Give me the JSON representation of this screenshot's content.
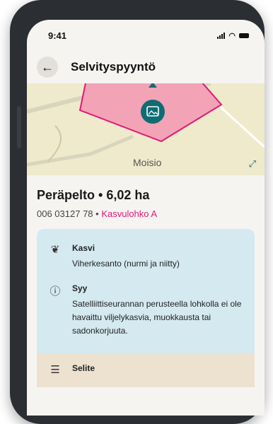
{
  "status": {
    "time": "9:41"
  },
  "appbar": {
    "title": "Selvityspyyntö",
    "back_icon": "arrow-left-icon"
  },
  "map": {
    "place_label": "Moisio",
    "parcel_color": "#f2a3b6",
    "border_color": "#e0197a",
    "marker_color": "#0f6c73"
  },
  "field": {
    "name": "Peräpelto • 6,02 ha",
    "id": "006 03127 78",
    "separator": " • ",
    "block": "Kasvulohko A"
  },
  "details": [
    {
      "icon": "leaf-icon",
      "label": "Kasvi",
      "value": "Viherkesanto (nurmi ja niitty)"
    },
    {
      "icon": "info-icon",
      "label": "Syy",
      "value": "Satelliittiseurannan perusteella lohkolla ei ole havaittu viljelykasvia, muokkausta tai sadonkorjuuta."
    },
    {
      "icon": "document-icon",
      "label": "Selite",
      "value": ""
    }
  ],
  "colors": {
    "accent": "#e0197a",
    "info_card": "#d4e9f0",
    "note_card": "#ede1cf"
  }
}
